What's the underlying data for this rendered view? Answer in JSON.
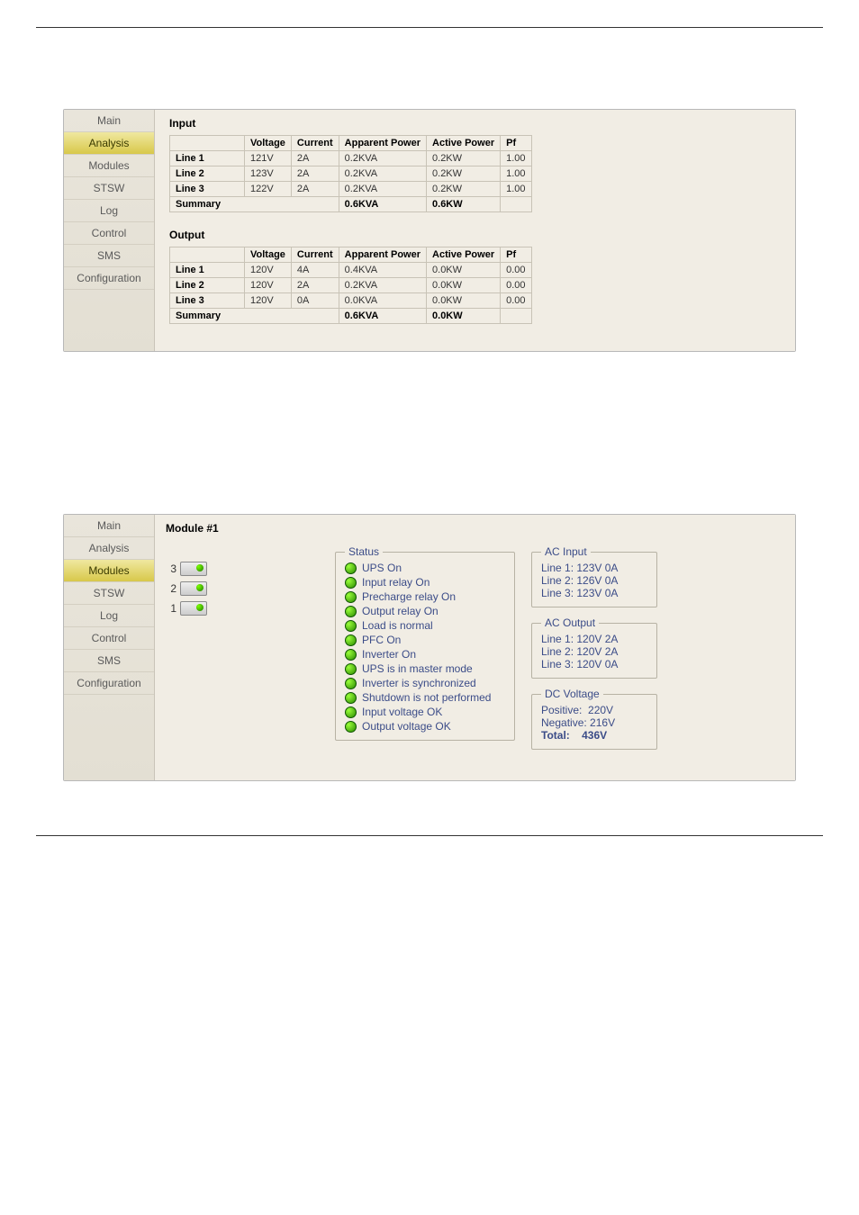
{
  "nav": {
    "panel1_active": "Analysis",
    "panel2_active": "Modules",
    "items": [
      "Main",
      "Analysis",
      "Modules",
      "STSW",
      "Log",
      "Control",
      "SMS",
      "Configuration"
    ]
  },
  "analysis": {
    "input_title": "Input",
    "output_title": "Output",
    "headers": [
      "",
      "Voltage",
      "Current",
      "Apparent Power",
      "Active Power",
      "Pf"
    ],
    "input_rows": [
      {
        "label": "Line 1",
        "voltage": "121V",
        "current": "2A",
        "apparent": "0.2KVA",
        "active": "0.2KW",
        "pf": "1.00"
      },
      {
        "label": "Line 2",
        "voltage": "123V",
        "current": "2A",
        "apparent": "0.2KVA",
        "active": "0.2KW",
        "pf": "1.00"
      },
      {
        "label": "Line 3",
        "voltage": "122V",
        "current": "2A",
        "apparent": "0.2KVA",
        "active": "0.2KW",
        "pf": "1.00"
      }
    ],
    "input_summary": {
      "label": "Summary",
      "apparent": "0.6KVA",
      "active": "0.6KW"
    },
    "output_rows": [
      {
        "label": "Line 1",
        "voltage": "120V",
        "current": "4A",
        "apparent": "0.4KVA",
        "active": "0.0KW",
        "pf": "0.00"
      },
      {
        "label": "Line 2",
        "voltage": "120V",
        "current": "2A",
        "apparent": "0.2KVA",
        "active": "0.0KW",
        "pf": "0.00"
      },
      {
        "label": "Line 3",
        "voltage": "120V",
        "current": "0A",
        "apparent": "0.0KVA",
        "active": "0.0KW",
        "pf": "0.00"
      }
    ],
    "output_summary": {
      "label": "Summary",
      "apparent": "0.6KVA",
      "active": "0.0KW"
    }
  },
  "module": {
    "title": "Module #1",
    "slots": [
      "3",
      "2",
      "1"
    ],
    "status_legend": "Status",
    "status": [
      "UPS On",
      "Input relay On",
      "Precharge relay On",
      "Output relay On",
      "Load is normal",
      "PFC On",
      "Inverter On",
      "UPS is in master mode",
      "Inverter is synchronized",
      "Shutdown is not performed",
      "Input voltage OK",
      "Output voltage OK"
    ],
    "ac_input": {
      "legend": "AC Input",
      "lines": [
        "Line 1: 123V 0A",
        "Line 2: 126V 0A",
        "Line 3: 123V 0A"
      ]
    },
    "ac_output": {
      "legend": "AC Output",
      "lines": [
        "Line 1: 120V 2A",
        "Line 2: 120V 2A",
        "Line 3: 120V 0A"
      ]
    },
    "dc": {
      "legend": "DC Voltage",
      "positive_label": "Positive:",
      "positive": "220V",
      "negative_label": "Negative:",
      "negative": "216V",
      "total_label": "Total:",
      "total": "436V"
    }
  }
}
